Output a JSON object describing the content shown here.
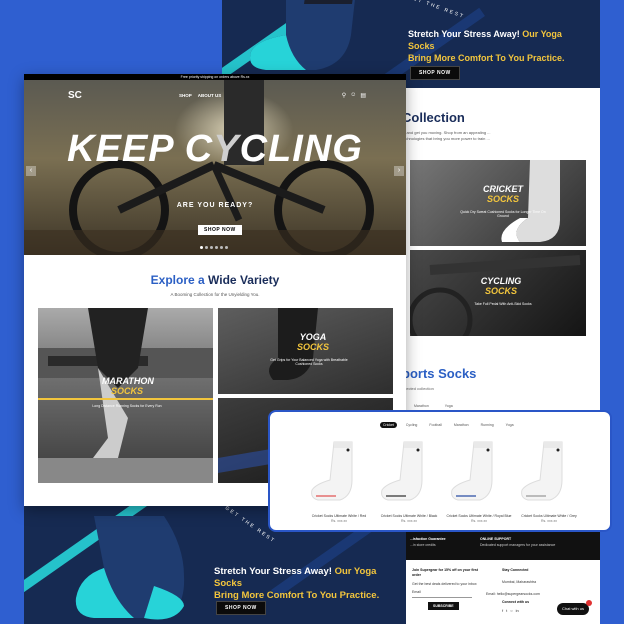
{
  "colors": {
    "bg_blue": "#2f5fd0",
    "navy": "#162a52",
    "teal": "#27d3d8",
    "yellow": "#f2c53d",
    "heading": "#1a2d5a",
    "accent": "#2b5fc4"
  },
  "top_promo": {
    "title_white": "Stretch Your Stress Away!",
    "title_yellow_1": "Our Yoga Socks",
    "title_yellow_2": "Bring More Comfort To You Practice.",
    "button": "SHOP NOW",
    "stamp": "GET THE REST"
  },
  "bottom_promo": {
    "title_white": "Stretch Your Stress Away!",
    "title_yellow_1": "Our Yoga Socks",
    "title_yellow_2": "Bring More Comfort To You Practice.",
    "button": "SHOP NOW",
    "stamp": "GET THE REST"
  },
  "main": {
    "announcement": "Free priority shipping on orders above Rs.xx",
    "logo": "SC",
    "nav_links": [
      "SHOP",
      "ABOUT US"
    ],
    "hero": {
      "title_1": "KEEP C",
      "title_2": "Y",
      "title_3": "CLING",
      "subtitle": "ARE YOU READY?",
      "button": "SHOP NOW"
    },
    "explore": {
      "title_1": "Explore a",
      "title_2": "Wide Variety",
      "subtitle": "A Booming Collection for the Unyielding You."
    },
    "categories": {
      "marathon": {
        "l1": "MARATHON",
        "l2": "SOCKS",
        "desc": "Long Distance Running Socks for Every Run"
      },
      "yoga": {
        "l1": "YOGA",
        "l2": "SOCKS",
        "desc": "Get Grips for Your Balanced Yoga with Breathable Cushioned Socks"
      },
      "cycling": {
        "l1": "CYCLING",
        "l2": "SOCKS",
        "desc": ""
      }
    }
  },
  "right_page": {
    "title": "Collection",
    "intro": "... and get you moving. Shop from an appealing ... technologies that bring you more power to train ...",
    "cricket": {
      "l1": "CRICKET",
      "l2": "SOCKS",
      "desc": "Quick Dry Sweat Cushioned Socks for Longer Time On Ground"
    },
    "cycling": {
      "l1": "CYCLING",
      "l2": "SOCKS",
      "desc": "Take Full Pedal With Anti-Skid Socks"
    },
    "sports_title": "ports Socks",
    "sports_sub": "...lected collection",
    "tab_preview": [
      "Marathon",
      "Yoga"
    ]
  },
  "modal": {
    "tabs": [
      "Cricket",
      "Cycling",
      "Football",
      "Marathon",
      "Running",
      "Yoga"
    ],
    "active_tab": 0,
    "products": [
      {
        "name": "Cricket Socks Ultimate White / Red",
        "price": "Rs. xxx.xx"
      },
      {
        "name": "Cricket Socks Ultimate White / Black",
        "price": "Rs. xxx.xx"
      },
      {
        "name": "Cricket Socks Ultimate White / Royal Blue",
        "price": "Rs. xxx.xx"
      },
      {
        "name": "Cricket Socks Ultimate White / Grey",
        "price": "Rs. xxx.xx"
      }
    ]
  },
  "footer": {
    "guarantee_title": "...isfaction Guarantee",
    "guarantee_text": "...in store credits",
    "support_title": "ONLINE SUPPORT",
    "support_text": "Dedicated support managers for your assistance",
    "signup_title": "Join Supergear for 15% off on your first order",
    "signup_text": "Get the best deals delivered to your inbox",
    "email_placeholder": "Email",
    "subscribe": "SUBSCRIBE",
    "connect_title": "Stay Connected",
    "address": "Mumbai, Maharashtra",
    "email_label": "Email: hello@supergearsocks.com",
    "connect_with": "Connect with us",
    "chat": "Chat with us"
  }
}
